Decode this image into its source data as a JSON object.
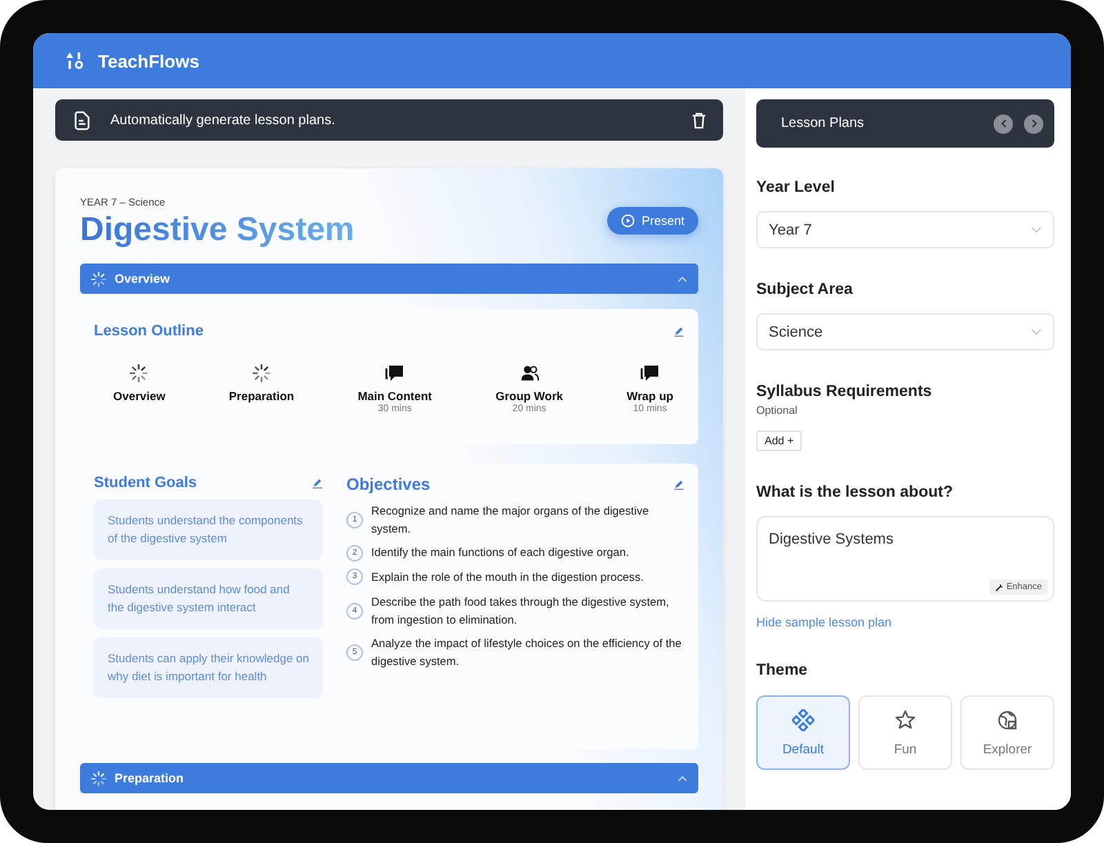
{
  "app": {
    "name": "TeachFlows"
  },
  "banner": {
    "text": "Automatically generate lesson plans."
  },
  "lesson": {
    "subtitle": "YEAR 7 – Science",
    "title": "Digestive System",
    "present_button": "Present"
  },
  "sections": [
    {
      "title": "Overview",
      "expanded": true
    },
    {
      "title": "Preparation",
      "expanded": true
    }
  ],
  "outline": {
    "title": "Lesson Outline",
    "steps": [
      {
        "kind": "loading",
        "label": "Overview"
      },
      {
        "kind": "loading",
        "label": "Preparation"
      },
      {
        "kind": "discussion",
        "label": "Main Content",
        "duration": "30 mins"
      },
      {
        "kind": "group",
        "label": "Group Work",
        "duration": "20 mins"
      },
      {
        "kind": "discussion",
        "label": "Wrap up",
        "duration": "10 mins"
      }
    ]
  },
  "goals": {
    "title": "Student Goals",
    "items": [
      "Students understand the components of the digestive system",
      "Students understand how food and the digestive system interact",
      "Students can apply their knowledge on why diet is important for health"
    ]
  },
  "objectives": {
    "title": "Objectives",
    "items": [
      {
        "number": "1",
        "text": "Recognize and name the major organs of the digestive system."
      },
      {
        "number": "2",
        "text": "Identify the main functions of each digestive organ."
      },
      {
        "number": "3",
        "text": "Explain the role of the mouth in the digestion process."
      },
      {
        "number": "4",
        "text": "Describe the path food takes through the digestive system, from ingestion to elimination."
      },
      {
        "number": "5",
        "text": "Analyze the impact of lifestyle choices on the efficiency of the digestive system."
      }
    ]
  },
  "sidebar": {
    "title": "Lesson Plans",
    "year_level": {
      "label": "Year Level",
      "value": "Year 7"
    },
    "subject_area": {
      "label": "Subject Area",
      "value": "Science"
    },
    "syllabus": {
      "label": "Syllabus Requirements",
      "hint": "Optional",
      "add_button": "Add +"
    },
    "about": {
      "label": "What is the lesson about?",
      "value": "Digestive Systems",
      "enhance_button": "Enhance"
    },
    "sample_link": "Hide sample lesson plan",
    "theme": {
      "label": "Theme",
      "options": [
        {
          "kind": "default",
          "label": "Default",
          "selected": true
        },
        {
          "kind": "fun",
          "label": "Fun",
          "selected": false
        },
        {
          "kind": "explorer",
          "label": "Explorer",
          "selected": false
        }
      ]
    }
  }
}
